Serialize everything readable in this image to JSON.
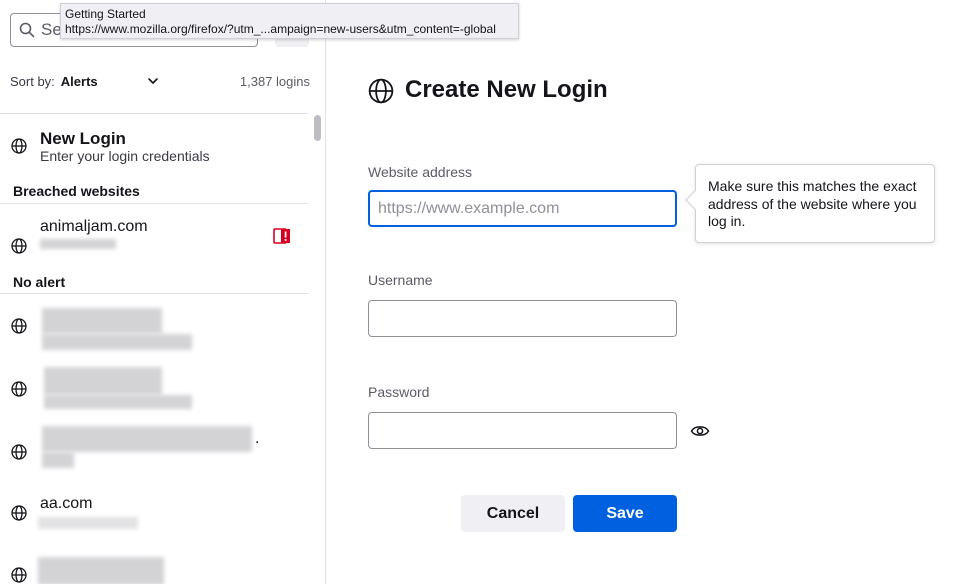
{
  "tooltip": {
    "title": "Getting Started",
    "url": "https://www.mozilla.org/firefox/?utm_...ampaign=new-users&utm_content=-global"
  },
  "sidebar": {
    "search_placeholder": "Search Logins",
    "sort_label": "Sort by:",
    "sort_value": "Alerts",
    "login_count": "1,387 logins",
    "new_login": {
      "title": "New Login",
      "subtitle": "Enter your login credentials"
    },
    "sections": {
      "breached": "Breached websites",
      "no_alert": "No alert"
    },
    "breached_items": [
      {
        "site": "animaljam.com"
      }
    ],
    "items": [
      {
        "site": "aa.com"
      }
    ],
    "trailing_char": "."
  },
  "main": {
    "title": "Create New Login",
    "website_label": "Website address",
    "website_placeholder": "https://www.example.com",
    "username_label": "Username",
    "password_label": "Password",
    "hint": "Make sure this matches the exact address of the website where you log in.",
    "cancel_label": "Cancel",
    "save_label": "Save"
  },
  "colors": {
    "accent": "#0061e0",
    "breach_alert": "#d70022",
    "secondary_button": "#f0f0f4"
  },
  "icons": [
    "search-icon",
    "globe-icon",
    "chevron-down-icon",
    "breach-alert-icon",
    "eye-icon"
  ]
}
